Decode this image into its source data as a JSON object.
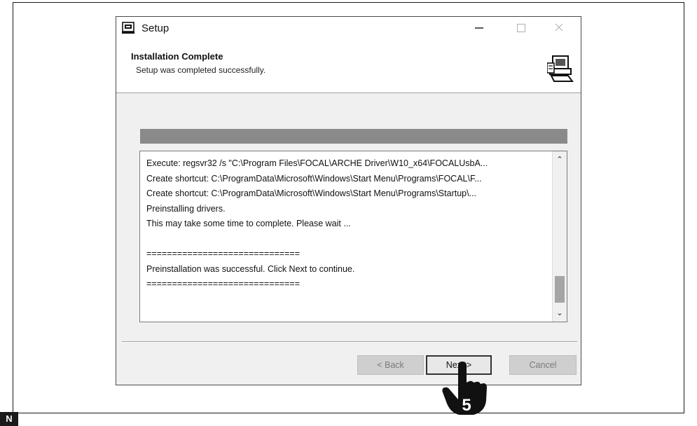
{
  "window": {
    "title": "Setup",
    "minimize_glyph": "—",
    "maximize_glyph": "☐",
    "close_glyph": "✕"
  },
  "header": {
    "title": "Installation Complete",
    "subtitle": "Setup was completed successfully."
  },
  "progress": {
    "fraction": 1.0
  },
  "log": {
    "lines": [
      "Execute: regsvr32 /s \"C:\\Program Files\\FOCAL\\ARCHE Driver\\W10_x64\\FOCALUsbA...",
      "Create shortcut: C:\\ProgramData\\Microsoft\\Windows\\Start Menu\\Programs\\FOCAL\\F...",
      "Create shortcut: C:\\ProgramData\\Microsoft\\Windows\\Start Menu\\Programs\\Startup\\...",
      "Preinstalling drivers.",
      "This may take some time to complete. Please wait ...",
      "",
      "==============================",
      "Preinstallation was successful. Click Next to continue.",
      "=============================="
    ],
    "scroll_up_glyph": "⌃",
    "scroll_down_glyph": "⌄"
  },
  "buttons": {
    "back": "< Back",
    "next": "Next >",
    "cancel": "Cancel"
  },
  "step_badge": "5",
  "corner_label": "N"
}
